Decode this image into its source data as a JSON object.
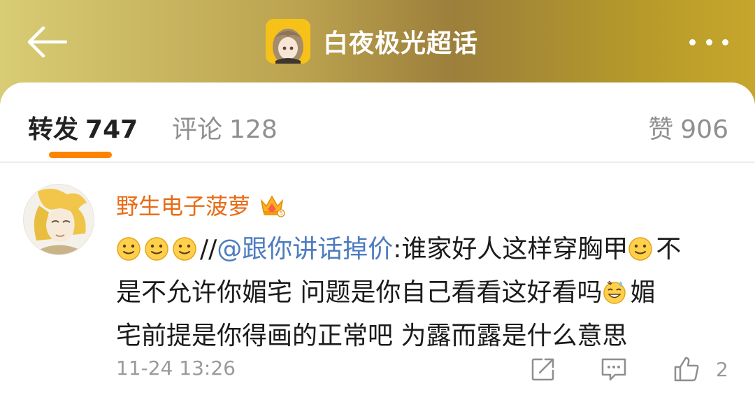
{
  "header": {
    "title": "白夜极光超话",
    "back_icon": "arrow-left-icon",
    "more_icon": "more-horizontal-icon",
    "gradient_colors": [
      "#d8cc74",
      "#9c7f3b",
      "#c7a62c"
    ]
  },
  "tabs": {
    "repost": {
      "label": "转发",
      "count": "747"
    },
    "comment": {
      "label": "评论",
      "count": "128"
    },
    "like": {
      "label": "赞",
      "count": "906"
    },
    "active": "repost",
    "accent_color": "#ff8200"
  },
  "comment": {
    "username": "野生电子菠萝",
    "badge_icon": "crown-badge-icon",
    "prefix": "//",
    "mention": "@跟你讲话掉价",
    "line1_rest": ":谁家好人这样穿胸甲",
    "line1_end": "不",
    "line2": "是不允许你媚宅 问题是你自己看看这好看吗",
    "line2_end": "媚",
    "line3": "宅前提是你得画的正常吧 为露而露是什么意思",
    "timestamp": "11-24 13:26",
    "like_count": "2",
    "username_color": "#e86b16",
    "mention_color": "#4e7cc0"
  }
}
